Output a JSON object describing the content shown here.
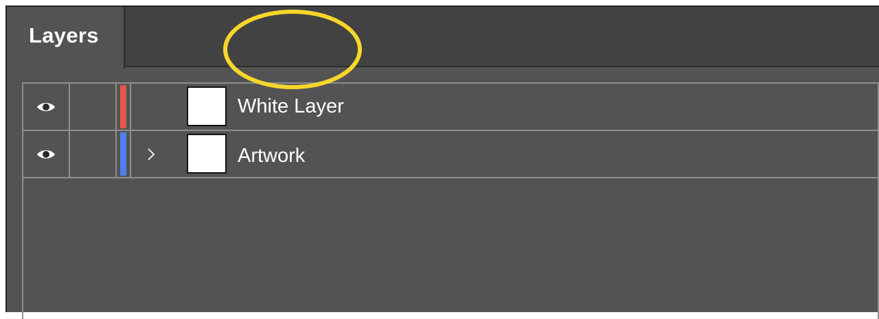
{
  "panel": {
    "tab_label": "Layers"
  },
  "layers": [
    {
      "name": "White Layer",
      "visible": true,
      "color": "#e5564a",
      "expandable": false,
      "thumbnail": "white"
    },
    {
      "name": "Artwork",
      "visible": true,
      "color": "#4e7ff0",
      "expandable": true,
      "thumbnail": "white"
    }
  ],
  "annotation": {
    "color": "#f7d62c",
    "target": "White Layer"
  },
  "icons": {
    "visibility": "eye-icon",
    "expand": "chevron-right-icon"
  }
}
